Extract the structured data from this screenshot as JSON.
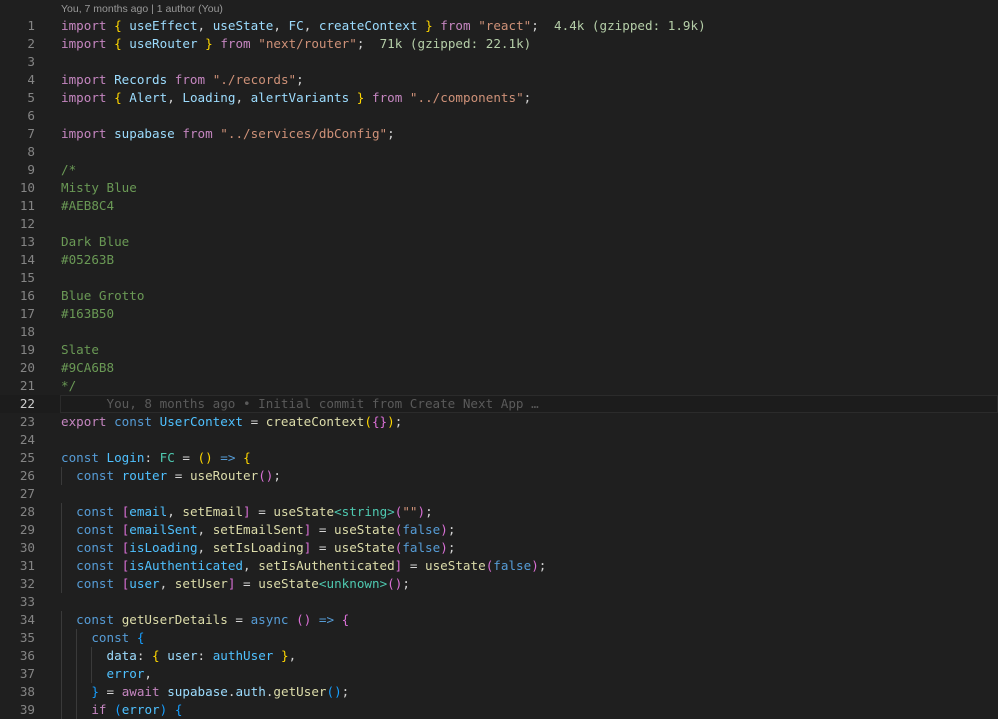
{
  "editor": {
    "codelens": "You, 7 months ago | 1 author (You)",
    "current_line": 22,
    "colors": {
      "background": "#1f1f1f",
      "line_number": "#858585",
      "keyword": "#c586c0",
      "declaration": "#569cd6",
      "string": "#ce9178",
      "variable": "#9cdcfe",
      "function": "#dcdcaa",
      "type": "#4ec9b0",
      "comment": "#6a9955",
      "bracket_gold": "#ffd700",
      "bracket_orchid": "#da70d6",
      "bracket_blue": "#179fff"
    },
    "lines": [
      {
        "n": 1,
        "tokens": [
          [
            "import",
            "kw"
          ],
          [
            " ",
            ""
          ],
          [
            "{",
            "bk1"
          ],
          [
            " ",
            ""
          ],
          [
            "useEffect",
            "var"
          ],
          [
            ", ",
            ""
          ],
          [
            "useState",
            "var"
          ],
          [
            ", ",
            ""
          ],
          [
            "FC",
            "var"
          ],
          [
            ", ",
            ""
          ],
          [
            "createContext",
            "var"
          ],
          [
            " ",
            ""
          ],
          [
            "}",
            "bk1"
          ],
          [
            " ",
            ""
          ],
          [
            "from",
            "kw"
          ],
          [
            " ",
            ""
          ],
          [
            "\"react\"",
            "str"
          ],
          [
            ";",
            ""
          ],
          [
            "  4.4k (gzipped: 1.9k)",
            "hint"
          ]
        ]
      },
      {
        "n": 2,
        "tokens": [
          [
            "import",
            "kw"
          ],
          [
            " ",
            ""
          ],
          [
            "{",
            "bk1"
          ],
          [
            " ",
            ""
          ],
          [
            "useRouter",
            "var"
          ],
          [
            " ",
            ""
          ],
          [
            "}",
            "bk1"
          ],
          [
            " ",
            ""
          ],
          [
            "from",
            "kw"
          ],
          [
            " ",
            ""
          ],
          [
            "\"next/router\"",
            "str"
          ],
          [
            ";",
            ""
          ],
          [
            "  71k (gzipped: 22.1k)",
            "hint"
          ]
        ]
      },
      {
        "n": 3,
        "tokens": []
      },
      {
        "n": 4,
        "tokens": [
          [
            "import",
            "kw"
          ],
          [
            " ",
            ""
          ],
          [
            "Records",
            "var"
          ],
          [
            " ",
            ""
          ],
          [
            "from",
            "kw"
          ],
          [
            " ",
            ""
          ],
          [
            "\"./records\"",
            "str"
          ],
          [
            ";",
            ""
          ]
        ]
      },
      {
        "n": 5,
        "tokens": [
          [
            "import",
            "kw"
          ],
          [
            " ",
            ""
          ],
          [
            "{",
            "bk1"
          ],
          [
            " ",
            ""
          ],
          [
            "Alert",
            "var"
          ],
          [
            ", ",
            ""
          ],
          [
            "Loading",
            "var"
          ],
          [
            ", ",
            ""
          ],
          [
            "alertVariants",
            "var"
          ],
          [
            " ",
            ""
          ],
          [
            "}",
            "bk1"
          ],
          [
            " ",
            ""
          ],
          [
            "from",
            "kw"
          ],
          [
            " ",
            ""
          ],
          [
            "\"../components\"",
            "str"
          ],
          [
            ";",
            ""
          ]
        ]
      },
      {
        "n": 6,
        "tokens": []
      },
      {
        "n": 7,
        "tokens": [
          [
            "import",
            "kw"
          ],
          [
            " ",
            ""
          ],
          [
            "supabase",
            "var"
          ],
          [
            " ",
            ""
          ],
          [
            "from",
            "kw"
          ],
          [
            " ",
            ""
          ],
          [
            "\"../services/dbConfig\"",
            "str"
          ],
          [
            ";",
            ""
          ]
        ]
      },
      {
        "n": 8,
        "tokens": []
      },
      {
        "n": 9,
        "tokens": [
          [
            "/*",
            "cm"
          ]
        ]
      },
      {
        "n": 10,
        "tokens": [
          [
            "Misty Blue",
            "cm"
          ]
        ]
      },
      {
        "n": 11,
        "tokens": [
          [
            "#AEB8C4",
            "cm"
          ]
        ]
      },
      {
        "n": 12,
        "tokens": []
      },
      {
        "n": 13,
        "tokens": [
          [
            "Dark Blue",
            "cm"
          ]
        ]
      },
      {
        "n": 14,
        "tokens": [
          [
            "#05263B",
            "cm"
          ]
        ]
      },
      {
        "n": 15,
        "tokens": []
      },
      {
        "n": 16,
        "tokens": [
          [
            "Blue Grotto",
            "cm"
          ]
        ]
      },
      {
        "n": 17,
        "tokens": [
          [
            "#163B50",
            "cm"
          ]
        ]
      },
      {
        "n": 18,
        "tokens": []
      },
      {
        "n": 19,
        "tokens": [
          [
            "Slate",
            "cm"
          ]
        ]
      },
      {
        "n": 20,
        "tokens": [
          [
            "#9CA6B8",
            "cm"
          ]
        ]
      },
      {
        "n": 21,
        "tokens": [
          [
            "*/",
            "cm"
          ]
        ]
      },
      {
        "n": 22,
        "tokens": [
          [
            "      You, 8 months ago • Initial commit from Create Next App …",
            "blame"
          ]
        ]
      },
      {
        "n": 23,
        "tokens": [
          [
            "export",
            "kw"
          ],
          [
            " ",
            ""
          ],
          [
            "const",
            "dkw"
          ],
          [
            " ",
            ""
          ],
          [
            "UserContext",
            "cst"
          ],
          [
            " = ",
            ""
          ],
          [
            "createContext",
            "fn"
          ],
          [
            "(",
            "bk1"
          ],
          [
            "{}",
            "bk2"
          ],
          [
            ")",
            "bk1"
          ],
          [
            ";",
            ""
          ]
        ]
      },
      {
        "n": 24,
        "tokens": []
      },
      {
        "n": 25,
        "tokens": [
          [
            "const",
            "dkw"
          ],
          [
            " ",
            ""
          ],
          [
            "Login",
            "cst"
          ],
          [
            ": ",
            ""
          ],
          [
            "FC",
            "ty"
          ],
          [
            " = ",
            ""
          ],
          [
            "()",
            "bk1"
          ],
          [
            " ",
            ""
          ],
          [
            "=>",
            "dkw"
          ],
          [
            " ",
            ""
          ],
          [
            "{",
            "bk1"
          ]
        ]
      },
      {
        "n": 26,
        "tokens": [
          [
            "  ",
            ""
          ],
          [
            "const",
            "dkw"
          ],
          [
            " ",
            ""
          ],
          [
            "router",
            "cst"
          ],
          [
            " = ",
            ""
          ],
          [
            "useRouter",
            "fn"
          ],
          [
            "()",
            "bk2"
          ],
          [
            ";",
            ""
          ]
        ]
      },
      {
        "n": 27,
        "tokens": []
      },
      {
        "n": 28,
        "tokens": [
          [
            "  ",
            ""
          ],
          [
            "const",
            "dkw"
          ],
          [
            " ",
            ""
          ],
          [
            "[",
            "bk2"
          ],
          [
            "email",
            "cst"
          ],
          [
            ", ",
            ""
          ],
          [
            "setEmail",
            "fn"
          ],
          [
            "]",
            "bk2"
          ],
          [
            " = ",
            ""
          ],
          [
            "useState",
            "fn"
          ],
          [
            "<",
            "ty"
          ],
          [
            "string",
            "ty"
          ],
          [
            ">",
            "ty"
          ],
          [
            "(",
            "bk2"
          ],
          [
            "\"\"",
            "str"
          ],
          [
            ")",
            "bk2"
          ],
          [
            ";",
            ""
          ]
        ]
      },
      {
        "n": 29,
        "tokens": [
          [
            "  ",
            ""
          ],
          [
            "const",
            "dkw"
          ],
          [
            " ",
            ""
          ],
          [
            "[",
            "bk2"
          ],
          [
            "emailSent",
            "cst"
          ],
          [
            ", ",
            ""
          ],
          [
            "setEmailSent",
            "fn"
          ],
          [
            "]",
            "bk2"
          ],
          [
            " = ",
            ""
          ],
          [
            "useState",
            "fn"
          ],
          [
            "(",
            "bk2"
          ],
          [
            "false",
            "dkw"
          ],
          [
            ")",
            "bk2"
          ],
          [
            ";",
            ""
          ]
        ]
      },
      {
        "n": 30,
        "tokens": [
          [
            "  ",
            ""
          ],
          [
            "const",
            "dkw"
          ],
          [
            " ",
            ""
          ],
          [
            "[",
            "bk2"
          ],
          [
            "isLoading",
            "cst"
          ],
          [
            ", ",
            ""
          ],
          [
            "setIsLoading",
            "fn"
          ],
          [
            "]",
            "bk2"
          ],
          [
            " = ",
            ""
          ],
          [
            "useState",
            "fn"
          ],
          [
            "(",
            "bk2"
          ],
          [
            "false",
            "dkw"
          ],
          [
            ")",
            "bk2"
          ],
          [
            ";",
            ""
          ]
        ]
      },
      {
        "n": 31,
        "tokens": [
          [
            "  ",
            ""
          ],
          [
            "const",
            "dkw"
          ],
          [
            " ",
            ""
          ],
          [
            "[",
            "bk2"
          ],
          [
            "isAuthenticated",
            "cst"
          ],
          [
            ", ",
            ""
          ],
          [
            "setIsAuthenticated",
            "fn"
          ],
          [
            "]",
            "bk2"
          ],
          [
            " = ",
            ""
          ],
          [
            "useState",
            "fn"
          ],
          [
            "(",
            "bk2"
          ],
          [
            "false",
            "dkw"
          ],
          [
            ")",
            "bk2"
          ],
          [
            ";",
            ""
          ]
        ]
      },
      {
        "n": 32,
        "tokens": [
          [
            "  ",
            ""
          ],
          [
            "const",
            "dkw"
          ],
          [
            " ",
            ""
          ],
          [
            "[",
            "bk2"
          ],
          [
            "user",
            "cst"
          ],
          [
            ", ",
            ""
          ],
          [
            "setUser",
            "fn"
          ],
          [
            "]",
            "bk2"
          ],
          [
            " = ",
            ""
          ],
          [
            "useState",
            "fn"
          ],
          [
            "<",
            "ty"
          ],
          [
            "unknown",
            "ty"
          ],
          [
            ">",
            "ty"
          ],
          [
            "()",
            "bk2"
          ],
          [
            ";",
            ""
          ]
        ]
      },
      {
        "n": 33,
        "tokens": []
      },
      {
        "n": 34,
        "tokens": [
          [
            "  ",
            ""
          ],
          [
            "const",
            "dkw"
          ],
          [
            " ",
            ""
          ],
          [
            "getUserDetails",
            "fn"
          ],
          [
            " = ",
            ""
          ],
          [
            "async",
            "dkw"
          ],
          [
            " ",
            ""
          ],
          [
            "()",
            "bk2"
          ],
          [
            " ",
            ""
          ],
          [
            "=>",
            "dkw"
          ],
          [
            " ",
            ""
          ],
          [
            "{",
            "bk2"
          ]
        ]
      },
      {
        "n": 35,
        "tokens": [
          [
            "    ",
            ""
          ],
          [
            "const",
            "dkw"
          ],
          [
            " ",
            ""
          ],
          [
            "{",
            "bk3"
          ]
        ]
      },
      {
        "n": 36,
        "tokens": [
          [
            "      ",
            ""
          ],
          [
            "data",
            "var"
          ],
          [
            ": ",
            ""
          ],
          [
            "{",
            "bk1"
          ],
          [
            " ",
            ""
          ],
          [
            "user",
            "var"
          ],
          [
            ": ",
            ""
          ],
          [
            "authUser",
            "cst"
          ],
          [
            " ",
            ""
          ],
          [
            "}",
            "bk1"
          ],
          [
            ",",
            ""
          ]
        ]
      },
      {
        "n": 37,
        "tokens": [
          [
            "      ",
            ""
          ],
          [
            "error",
            "cst"
          ],
          [
            ",",
            ""
          ]
        ]
      },
      {
        "n": 38,
        "tokens": [
          [
            "    ",
            ""
          ],
          [
            "}",
            "bk3"
          ],
          [
            " = ",
            ""
          ],
          [
            "await",
            "kw"
          ],
          [
            " ",
            ""
          ],
          [
            "supabase",
            "var"
          ],
          [
            ".",
            ""
          ],
          [
            "auth",
            "var"
          ],
          [
            ".",
            ""
          ],
          [
            "getUser",
            "fn"
          ],
          [
            "()",
            "bk3"
          ],
          [
            ";",
            ""
          ]
        ]
      },
      {
        "n": 39,
        "tokens": [
          [
            "    ",
            ""
          ],
          [
            "if",
            "kw"
          ],
          [
            " ",
            ""
          ],
          [
            "(",
            "bk3"
          ],
          [
            "error",
            "cst"
          ],
          [
            ")",
            "bk3"
          ],
          [
            " ",
            ""
          ],
          [
            "{",
            "bk3"
          ]
        ]
      }
    ]
  }
}
